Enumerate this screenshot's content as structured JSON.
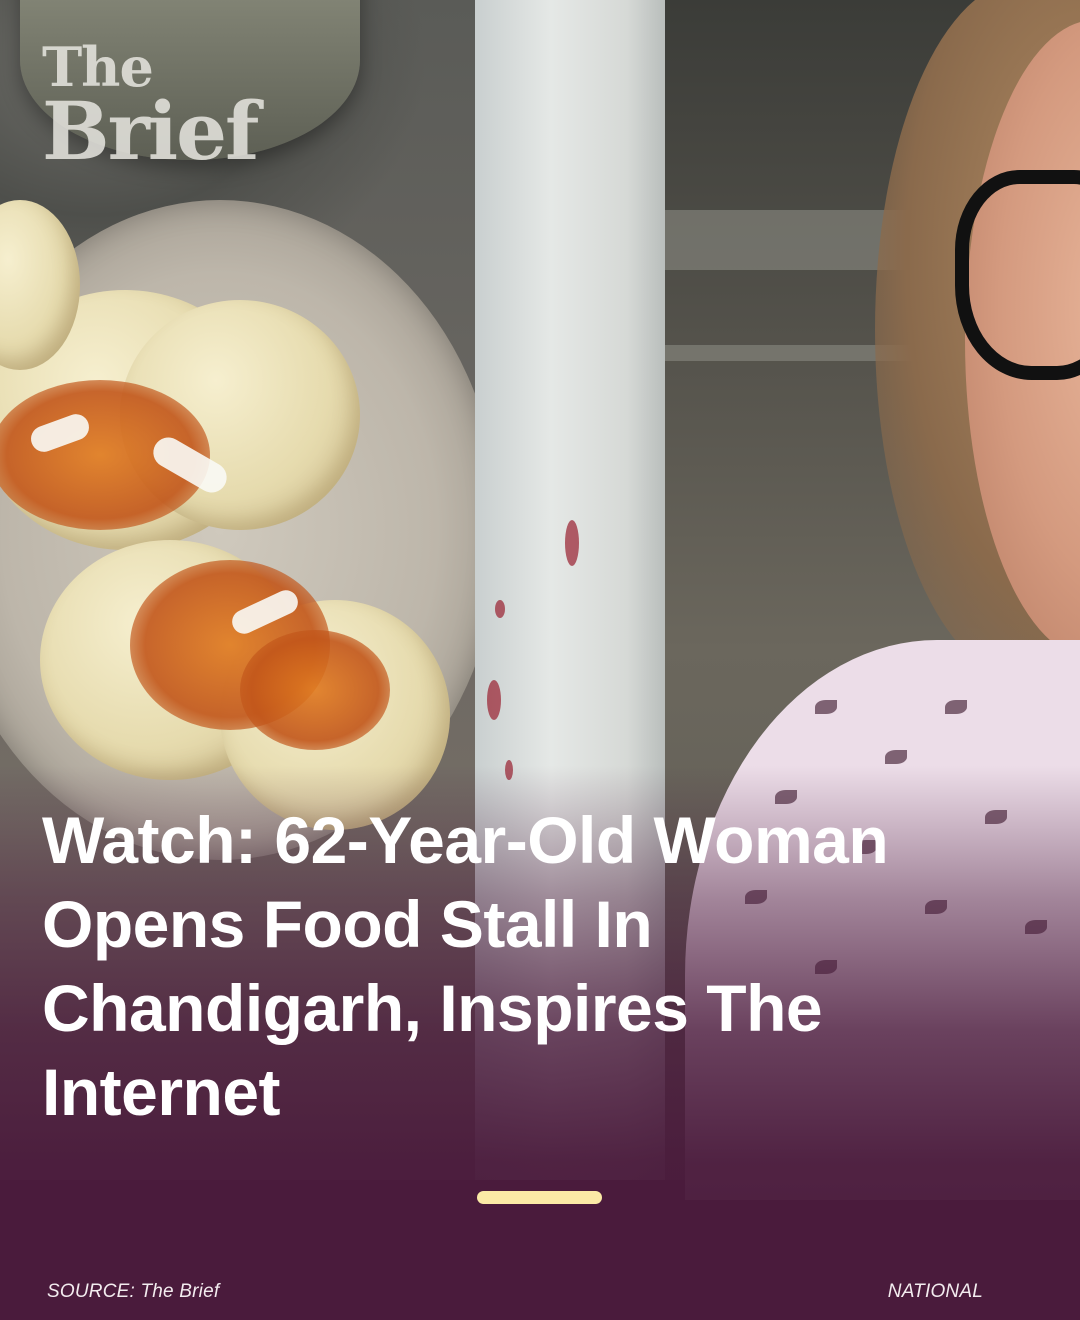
{
  "logo": {
    "line1": "The",
    "line2": "Brief"
  },
  "headline": "Watch: 62-Year-Old Woman Opens Food Stall In Chandigarh, Inspires The Internet",
  "footer": {
    "source": "SOURCE: The Brief",
    "category": "NATIONAL"
  },
  "colors": {
    "background": "#4a1b3c",
    "headline": "#ffffff",
    "indicator": "#fbeaa6",
    "footer_text": "#f3ecef"
  }
}
